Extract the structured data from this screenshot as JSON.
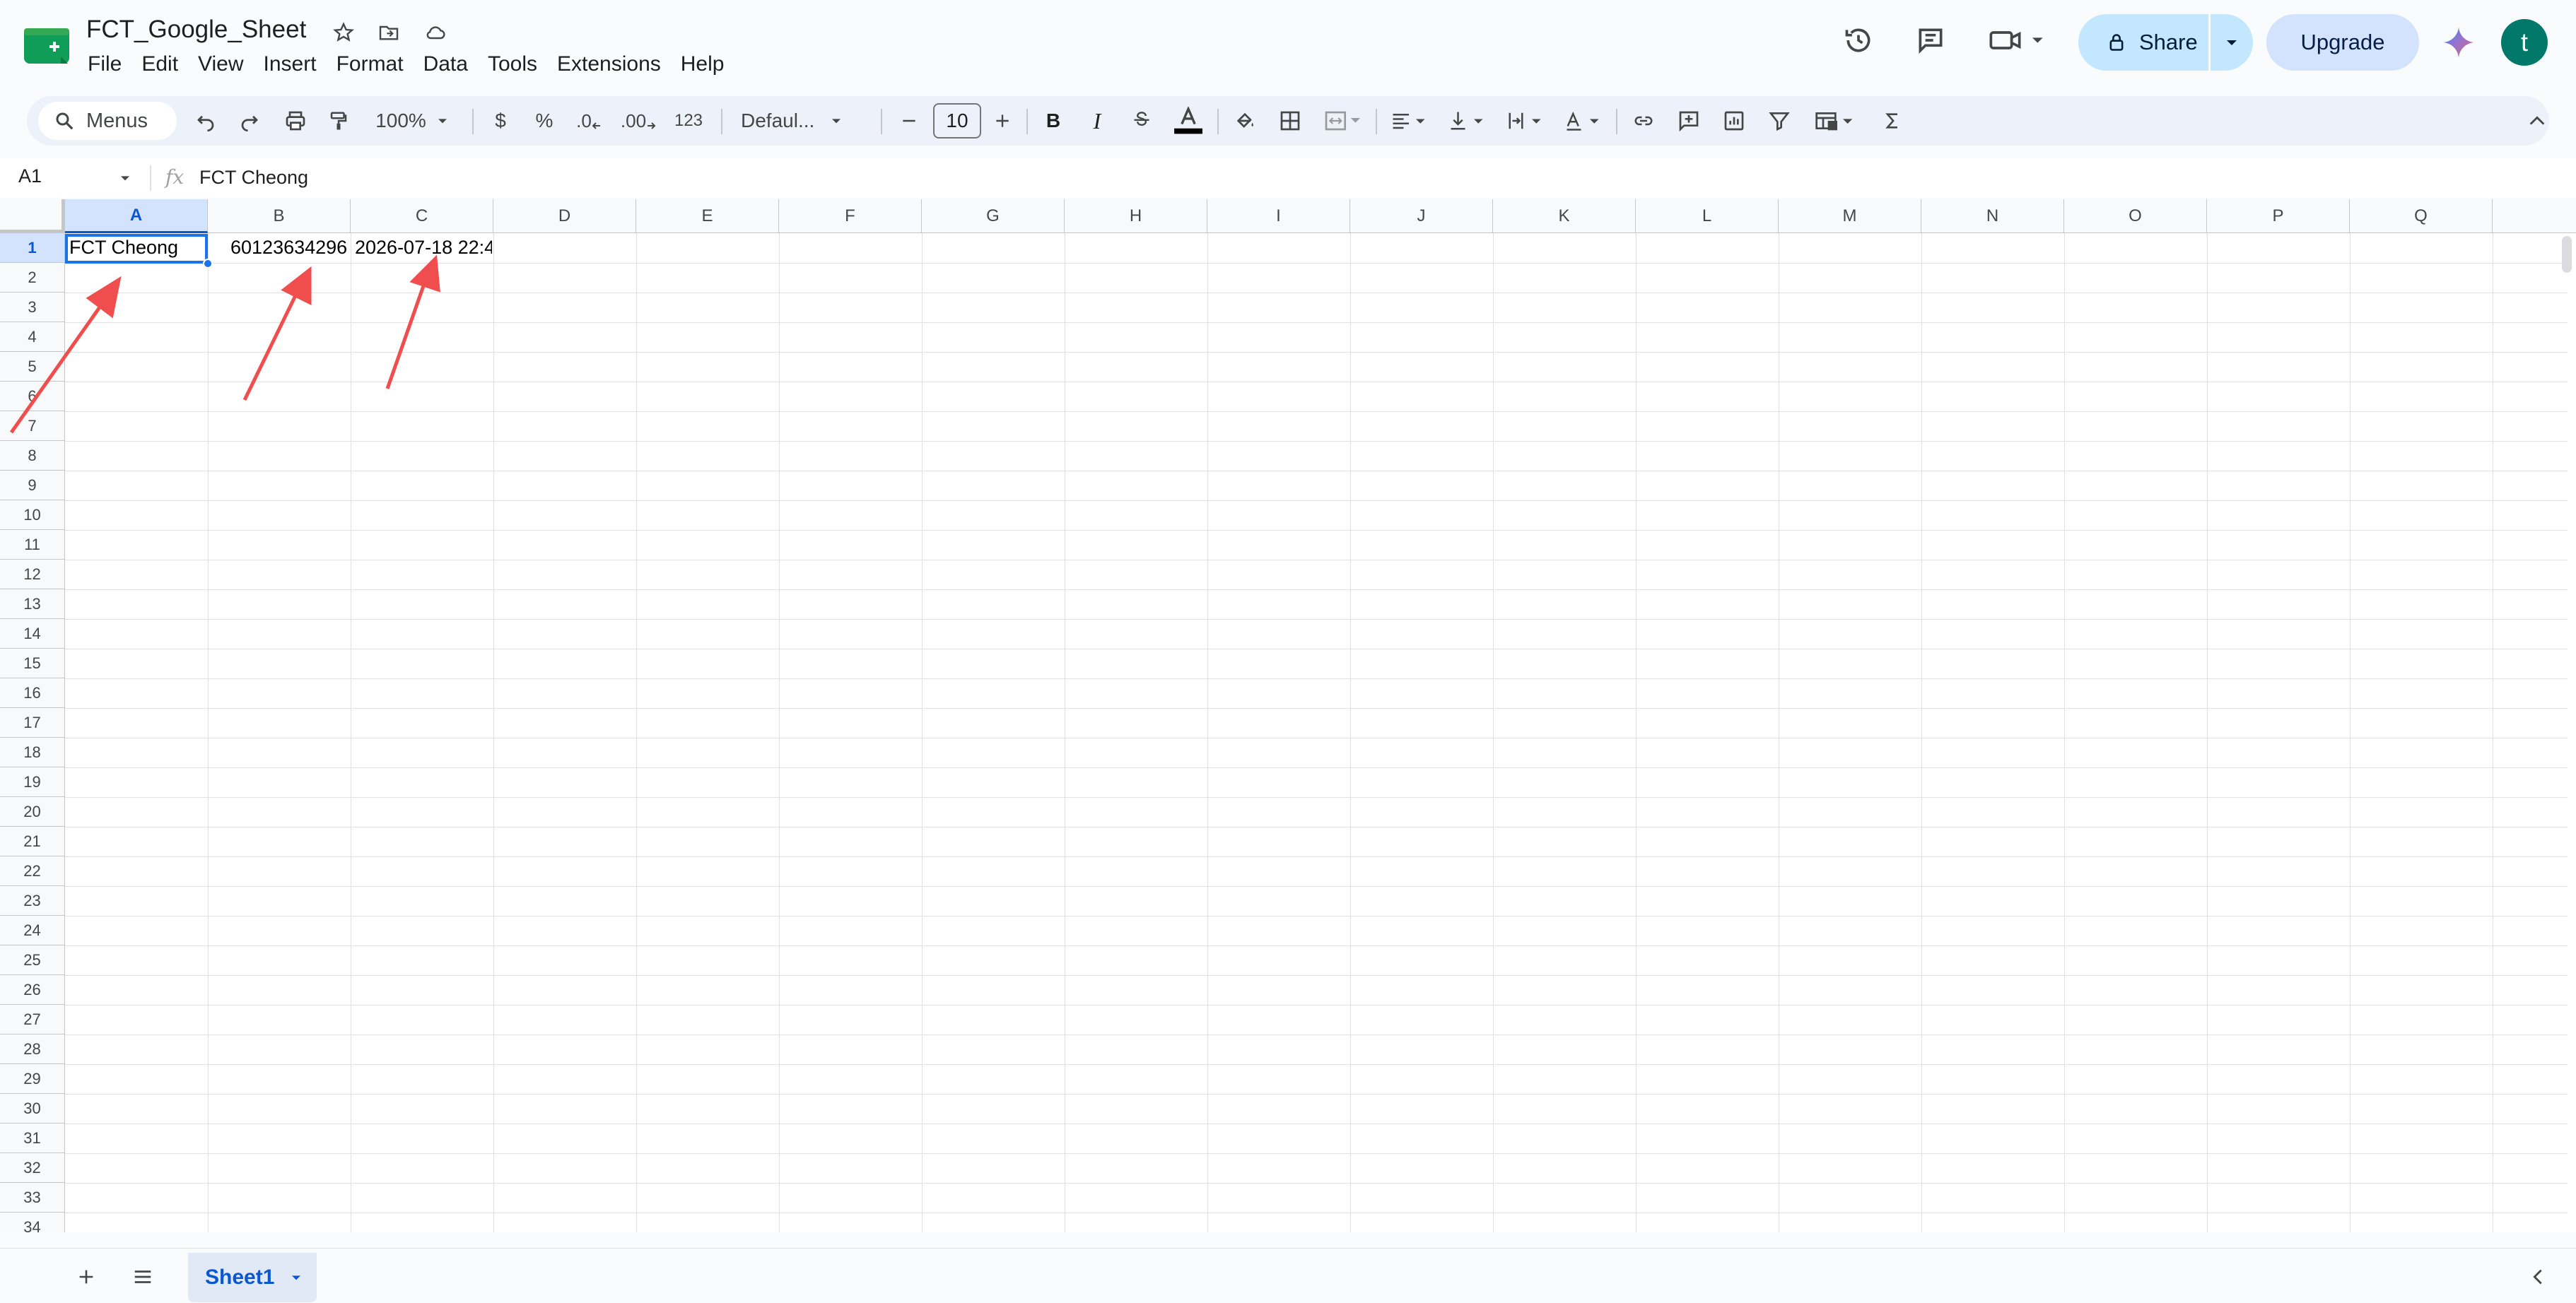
{
  "document": {
    "title": "FCT_Google_Sheet"
  },
  "menu": {
    "items": [
      "File",
      "Edit",
      "View",
      "Insert",
      "Format",
      "Data",
      "Tools",
      "Extensions",
      "Help"
    ]
  },
  "header": {
    "share_label": "Share",
    "upgrade_label": "Upgrade",
    "avatar_initial": "t"
  },
  "toolbar": {
    "menus_label": "Menus",
    "zoom": "100%",
    "currency": "$",
    "percent": "%",
    "decrease_decimals": ".0",
    "increase_decimals": ".00",
    "number_format": "123",
    "font": "Defaul...",
    "font_size": "10",
    "bold": "B",
    "italic": "I"
  },
  "formula_bar": {
    "cell_ref": "A1",
    "fx": "fx",
    "value": "FCT Cheong"
  },
  "grid": {
    "columns": [
      "A",
      "B",
      "C",
      "D",
      "E",
      "F",
      "G",
      "H",
      "I",
      "J",
      "K",
      "L",
      "M",
      "N",
      "O",
      "P",
      "Q"
    ],
    "rows": [
      "1",
      "2",
      "3",
      "4",
      "5",
      "6",
      "7",
      "8",
      "9",
      "10",
      "11",
      "12",
      "13",
      "14",
      "15",
      "16",
      "17",
      "18",
      "19",
      "20",
      "21",
      "22",
      "23",
      "24",
      "25",
      "26",
      "27",
      "28",
      "29",
      "30",
      "31",
      "32",
      "33",
      "34"
    ],
    "selected_column": "A",
    "selected_row": "1",
    "cells": {
      "A1": "FCT Cheong",
      "B1": "60123634296",
      "C1": "2026-07-18 22:4"
    }
  },
  "sheets": {
    "tabs": [
      "Sheet1"
    ],
    "active": "Sheet1"
  },
  "colors": {
    "accent": "#1a73e8",
    "share_bg": "#c2e7ff",
    "upgrade_bg": "#d3e3fd",
    "annotation_arrow": "#f04e4e",
    "avatar_bg": "#00796b"
  }
}
